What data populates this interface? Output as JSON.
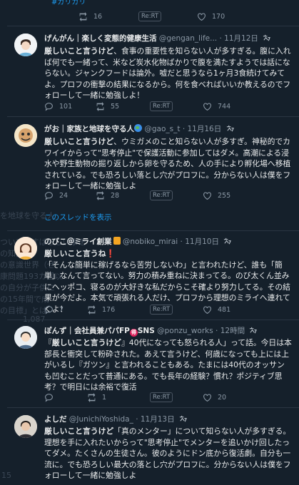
{
  "background_fragments": [
    "を地球を守る人",
    "ついてのすばらしい事を",
    "の知識が",
    "の意識世界（ぜ",
    "康問題193カ国以",
    "の自分が子供に",
    "の15年間で成",
    "の目標」とは",
    "1,087",
    "15"
  ],
  "top": {
    "hashtag": "#ガリガリ",
    "reply": "",
    "retweet": "16",
    "rert": "Re:RT",
    "like": "170"
  },
  "thread_link": "このスレッドを表示",
  "tweets": [
    {
      "name": "げんがん｜楽しく変態的健康生活",
      "handle": "@gengan_life...",
      "time": "· 11月12日",
      "body_bold": "厳しいこと言うけど",
      "body": "、食事の重要性を知らない人が多すぎる。腹に入れば何でも一緒って、米など炭水化物ばかりで腹を満たすようでは話にならない。ジャンクフードは論外。嘘だと思うなら1ヶ月3食続けてみてよ。プロフの衝撃の結果になるから。何を食べればいいか教えるのでフォローして一緒に勉強しよ！",
      "reply": "101",
      "retweet": "55",
      "rert": "Re:RT",
      "like": "744"
    },
    {
      "name": "がお｜家族と地球を守る人",
      "handle": "@gao_s_t",
      "time": "· 11月16日",
      "body_bold": "厳しいこと言うけど",
      "body": "、ウミガメのこと知らない人が多すぎ。神秘的でカワイイからって\"思考停止\"で保護活動に参加してはダメ。高潮による浸水や野生動物の掘り返しから卵を守るため、人の手により孵化場へ移植されている。でも恐ろしい落とし穴がプロフに。分からない人は僕をフォローして一緒に勉強しよ",
      "reply": "24",
      "retweet": "28",
      "rert": "Re:RT",
      "like": "255"
    },
    {
      "name": "のびこ＠ミライ創業",
      "handle": "@nobiko_mirai",
      "time": "· 11月10日",
      "body_bold": "厳しいこと言うね",
      "body": "「そんな簡単に稼げるなら苦労しないわ」と言われたけど、誰も「簡単」なんて言ってない。努力の積み重ねに決まってる。のび太くん並みにヘッポコ、寝るのが大好きな私だからこそ確より努力してる。その結果が今だよ。本気で頑張れる人だけ、プロフから理想のミライへ連れてくよ！",
      "reply": "7",
      "retweet": "176",
      "rert": "Re:RT",
      "like": "481"
    },
    {
      "name": "ぽんず｜会社員兼パパFP",
      "handle": "@ponzu_works",
      "time": "· 12時間",
      "body_bold": "厳しいこと言うけど",
      "body": "40代になっても怒られる人」って話。今日は本部長と衝突して粉砕された。あえて言うけど、何歳になっても上には上がいるし『ガツン』と言われることもある。たまには40代のオッサンも凹むことだって普通にある。でも長年の経験？慣れ？ポジティブ思考？で明日には余裕で復活",
      "reply": "",
      "retweet": "1",
      "rert": "Re:RT",
      "like": "20"
    },
    {
      "name": "よしだ",
      "handle": "@JunichiYoshida_",
      "time": "· 11月13日",
      "body_bold": "厳しいこと言うけど",
      "body": "「真のメンター」について知らない人が多すぎる。理想を手に入れたいからって\"思考停止\"でメンターを追いかけ回したってダメ。たくさんの生徒さん。彼のようにドン底から復活劇。自分も一流に。でも恐ろしい最大の落とし穴がプロフに。分からない人は僕をフォローして一緒に勉強しよ",
      "reply": "",
      "retweet": "",
      "rert": "",
      "like": ""
    }
  ]
}
